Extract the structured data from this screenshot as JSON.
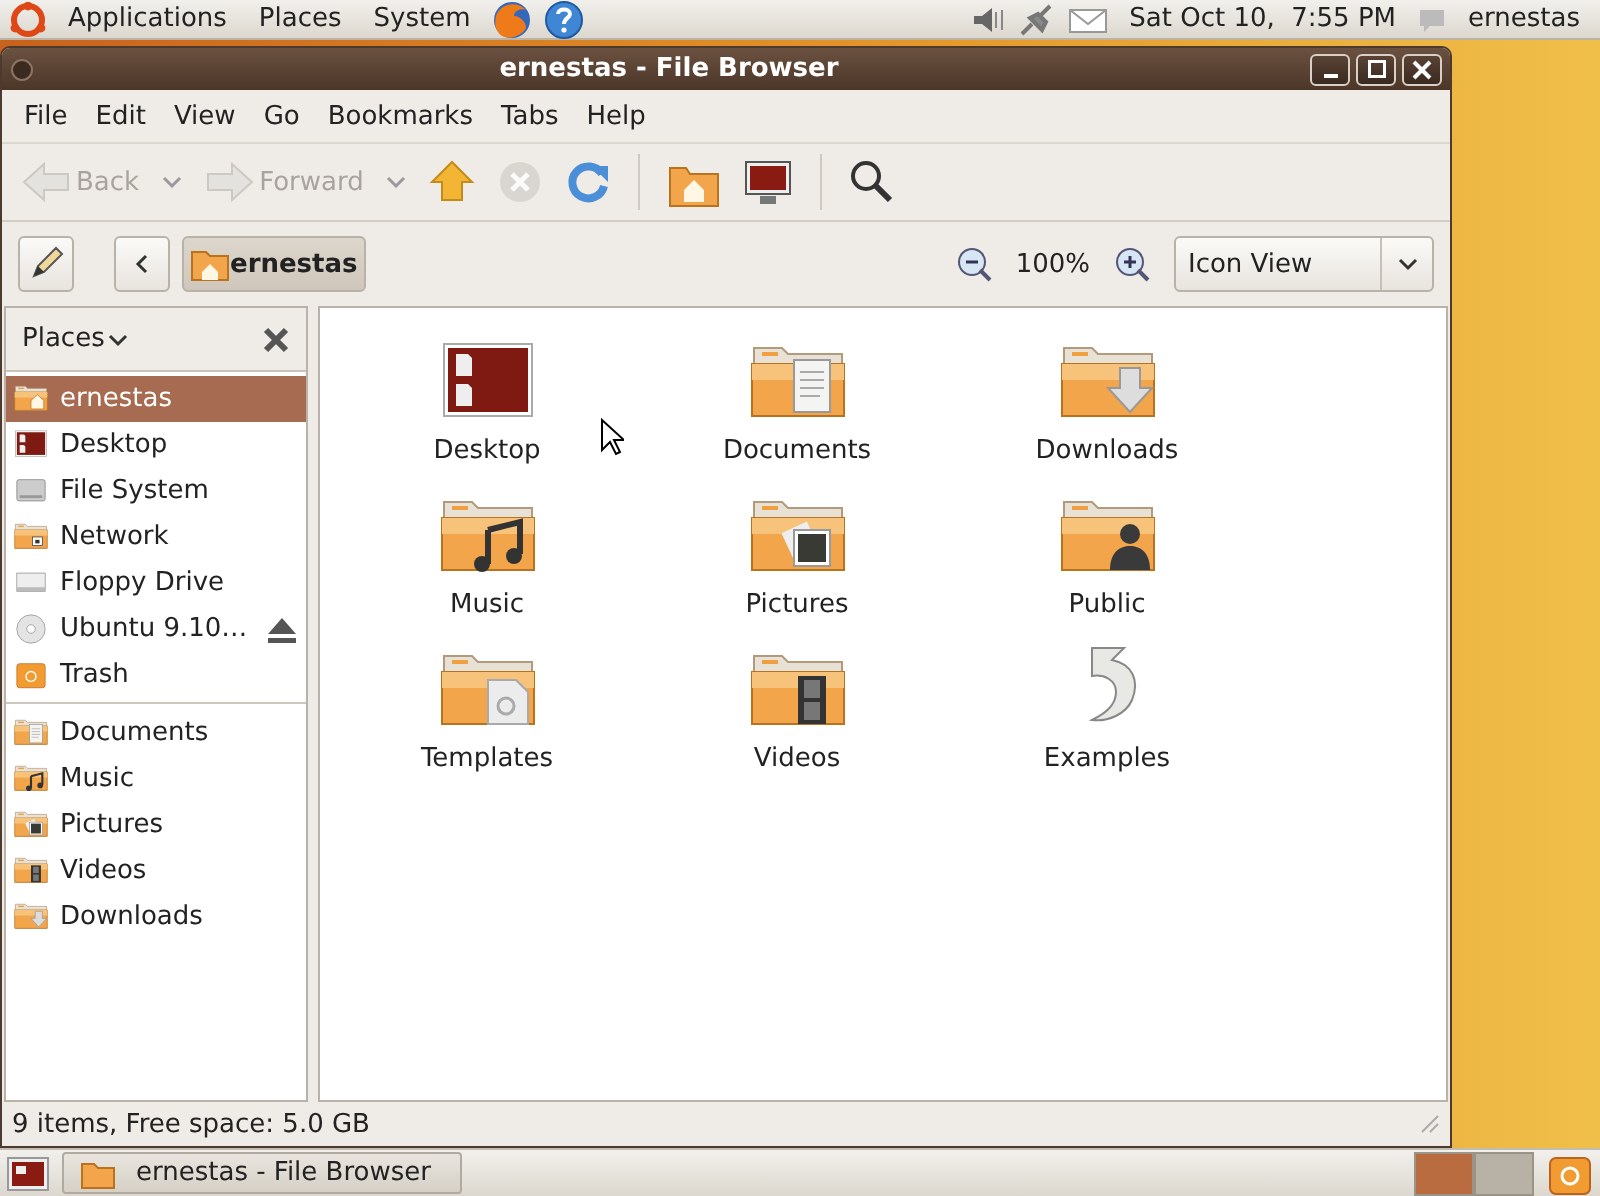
{
  "top_panel": {
    "menus": [
      "Applications",
      "Places",
      "System"
    ],
    "launchers": [
      {
        "kind": "firefox"
      },
      {
        "kind": "help"
      }
    ],
    "clock": "Sat Oct 10,  7:55 PM",
    "user": "ernestas"
  },
  "window": {
    "title": "ernestas - File Browser"
  },
  "menubar": [
    "File",
    "Edit",
    "View",
    "Go",
    "Bookmarks",
    "Tabs",
    "Help"
  ],
  "toolbar": [
    {
      "kind": "back",
      "label": "Back",
      "disabled": true,
      "menu": true
    },
    {
      "kind": "forward",
      "label": "Forward",
      "disabled": true,
      "menu": true
    },
    {
      "kind": "up",
      "disabled": false
    },
    {
      "kind": "stop",
      "disabled": true
    },
    {
      "kind": "reload",
      "disabled": false
    },
    {
      "kind": "separator"
    },
    {
      "kind": "home",
      "disabled": false
    },
    {
      "kind": "computer",
      "disabled": false
    },
    {
      "kind": "separator"
    },
    {
      "kind": "search",
      "disabled": false
    }
  ],
  "location_bar": {
    "path": [
      {
        "label": "ernestas",
        "selected": true
      }
    ],
    "zoom": "100%",
    "view": "Icon View"
  },
  "sidebar": {
    "title": "Places",
    "places": [
      {
        "kind": "home",
        "label": "ernestas",
        "selected": true
      },
      {
        "kind": "desktop",
        "label": "Desktop",
        "selected": false
      },
      {
        "kind": "filesystem",
        "label": "File System",
        "selected": false
      },
      {
        "kind": "network",
        "label": "Network",
        "selected": false
      },
      {
        "kind": "floppy",
        "label": "Floppy Drive",
        "selected": false
      },
      {
        "kind": "disc",
        "label": "Ubuntu 9.10…",
        "selected": false,
        "eject": true
      },
      {
        "kind": "trash",
        "label": "Trash",
        "selected": false
      }
    ],
    "bookmarks": [
      {
        "kind": "documents",
        "label": "Documents",
        "selected": false
      },
      {
        "kind": "music",
        "label": "Music",
        "selected": false
      },
      {
        "kind": "pictures",
        "label": "Pictures",
        "selected": false
      },
      {
        "kind": "videos",
        "label": "Videos",
        "selected": false
      },
      {
        "kind": "downloads",
        "label": "Downloads",
        "selected": false
      }
    ]
  },
  "files": [
    {
      "kind": "desktop",
      "label": "Desktop"
    },
    {
      "kind": "documents",
      "label": "Documents"
    },
    {
      "kind": "downloads",
      "label": "Downloads"
    },
    {
      "kind": "music",
      "label": "Music"
    },
    {
      "kind": "pictures",
      "label": "Pictures"
    },
    {
      "kind": "public",
      "label": "Public"
    },
    {
      "kind": "templates",
      "label": "Templates"
    },
    {
      "kind": "videos",
      "label": "Videos"
    },
    {
      "kind": "examples",
      "label": "Examples"
    }
  ],
  "status_bar": "9 items, Free space: 5.0 GB",
  "taskbar": {
    "tasks": [
      {
        "label": "ernestas - File Browser",
        "selected": false
      }
    ],
    "workspaces": [
      {
        "selected": true
      },
      {
        "selected": false
      }
    ]
  }
}
